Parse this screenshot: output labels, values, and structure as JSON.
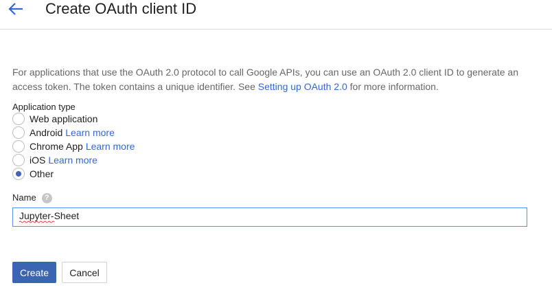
{
  "header": {
    "title": "Create OAuth client ID",
    "back_icon": "arrow-left-icon"
  },
  "description": {
    "text_before": "For applications that use the OAuth 2.0 protocol to call Google APIs, you can use an OAuth 2.0 client ID to generate an access token. The token contains a unique identifier. See ",
    "link": "Setting up OAuth 2.0",
    "text_after": " for more information."
  },
  "application_type": {
    "label": "Application type",
    "selected": "Other",
    "options": [
      {
        "label": "Web application",
        "link": ""
      },
      {
        "label": "Android",
        "link": "Learn more"
      },
      {
        "label": "Chrome App",
        "link": "Learn more"
      },
      {
        "label": "iOS",
        "link": "Learn more"
      },
      {
        "label": "Other",
        "link": ""
      }
    ]
  },
  "name_field": {
    "label": "Name",
    "help_glyph": "?",
    "value": "Jupyter-Sheet"
  },
  "buttons": {
    "create": "Create",
    "cancel": "Cancel"
  },
  "colors": {
    "accent": "#3b64b3",
    "link": "#3367d6",
    "focus_border": "#4d90fe"
  }
}
